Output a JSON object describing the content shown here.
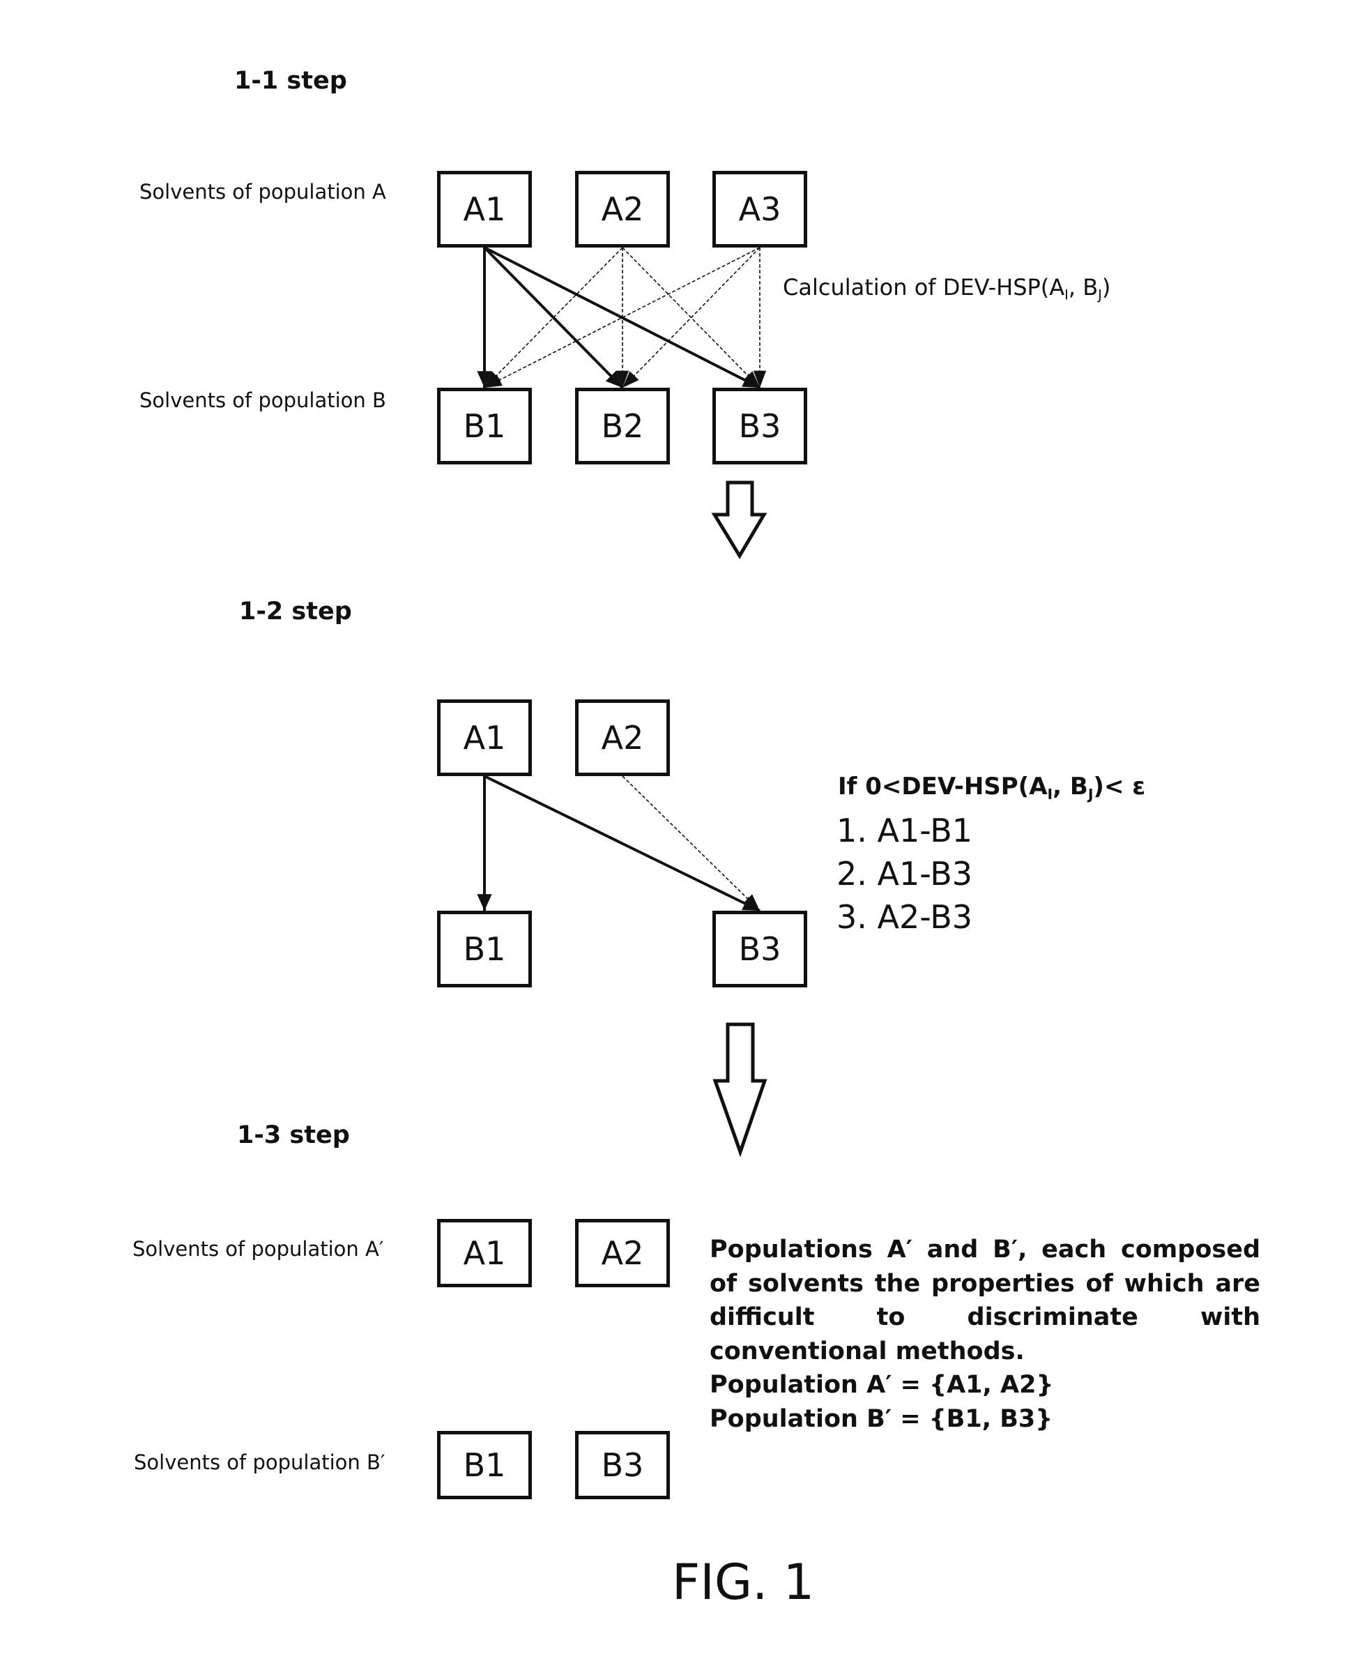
{
  "figure_label": "FIG. 1",
  "step1": {
    "title": "1-1 step",
    "label_a": "Solvents of population A",
    "label_b": "Solvents of population B",
    "nodes_a": [
      "A1",
      "A2",
      "A3"
    ],
    "nodes_b": [
      "B1",
      "B2",
      "B3"
    ],
    "calc_prefix": "Calculation of DEV-HSP(A",
    "calc_sub_i": "I",
    "calc_mid": ", B",
    "calc_sub_j": "J",
    "calc_suffix": ")",
    "edges": [
      {
        "from": "A1",
        "to": "B1",
        "weight": "bold"
      },
      {
        "from": "A1",
        "to": "B2",
        "weight": "bold"
      },
      {
        "from": "A1",
        "to": "B3",
        "weight": "bold"
      },
      {
        "from": "A2",
        "to": "B1",
        "weight": "thin"
      },
      {
        "from": "A2",
        "to": "B2",
        "weight": "thin"
      },
      {
        "from": "A2",
        "to": "B3",
        "weight": "thin"
      },
      {
        "from": "A3",
        "to": "B1",
        "weight": "thin"
      },
      {
        "from": "A3",
        "to": "B2",
        "weight": "thin"
      },
      {
        "from": "A3",
        "to": "B3",
        "weight": "thin"
      }
    ]
  },
  "step2": {
    "title": "1-2 step",
    "nodes_a": [
      "A1",
      "A2"
    ],
    "nodes_b": [
      "B1",
      "B3"
    ],
    "condition_prefix": "If 0<DEV-HSP(A",
    "condition_sub_i": "I",
    "condition_mid": ", B",
    "condition_sub_j": "J",
    "condition_suffix": ")< ε",
    "pairs": [
      "1. A1-B1",
      "2. A1-B3",
      "3. A2-B3"
    ],
    "edges": [
      {
        "from": "A1",
        "to": "B1",
        "weight": "bold"
      },
      {
        "from": "A1",
        "to": "B3",
        "weight": "bold"
      },
      {
        "from": "A2",
        "to": "B3",
        "weight": "thin"
      }
    ]
  },
  "step3": {
    "title": "1-3 step",
    "label_a": "Solvents of population A′",
    "label_b": "Solvents of population B′",
    "nodes_a": [
      "A1",
      "A2"
    ],
    "nodes_b": [
      "B1",
      "B3"
    ],
    "description": "Populations A′ and B′, each composed of solvents the properties of which are difficult to discriminate with conventional methods.",
    "population_a": "Population A′ = {A1, A2}",
    "population_b": "Population B′ = {B1, B3}"
  },
  "icons": {
    "step_transition": "down-arrow-outline-icon"
  }
}
